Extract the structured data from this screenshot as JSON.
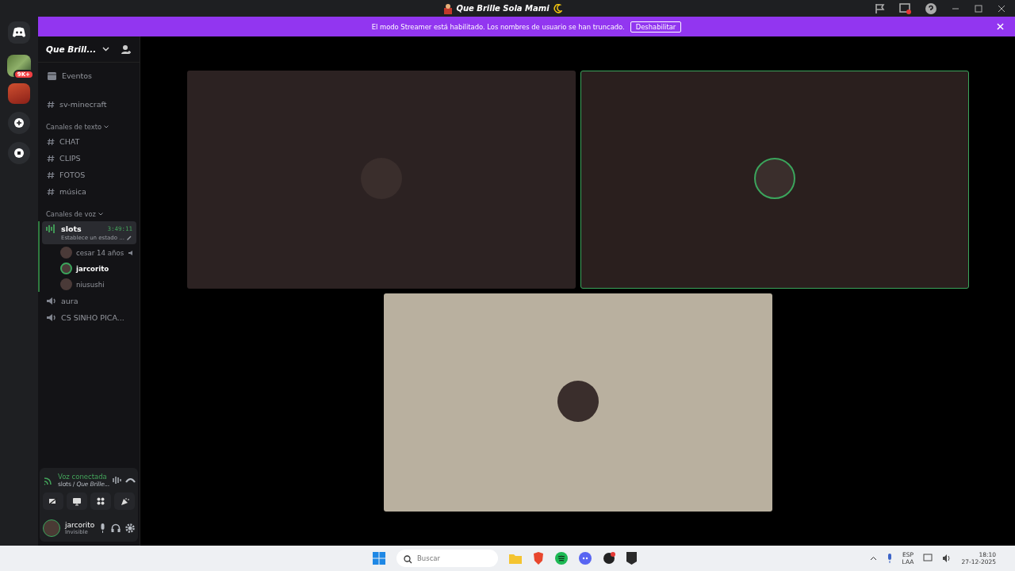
{
  "window": {
    "title": "Que Brille Sola Mami"
  },
  "banner": {
    "text": "El modo Streamer está habilitado. Los nombres de usuario se han truncado.",
    "button": "Deshabilitar"
  },
  "server_rail": {
    "badge": "9K+"
  },
  "server": {
    "name": "Que Brill..."
  },
  "top_channels": [
    {
      "kind": "events",
      "name": "Eventos"
    },
    {
      "kind": "text",
      "name": "sv-minecraft"
    }
  ],
  "categories": [
    {
      "name": "Canales de texto",
      "channels": [
        {
          "kind": "text",
          "name": "CHAT",
          "selected": false
        },
        {
          "kind": "text",
          "name": "CLIPS",
          "selected": false
        },
        {
          "kind": "text",
          "name": "FOTOS",
          "selected": false
        },
        {
          "kind": "text",
          "name": "música",
          "selected": false
        }
      ]
    },
    {
      "name": "Canales de voz",
      "channels": [
        {
          "kind": "voice",
          "name": "slots",
          "selected": true,
          "timer": "3:49:11",
          "status": "Establece un estado ...",
          "members": [
            {
              "name": "cesar 14 años",
              "speaking": false,
              "muted": true
            },
            {
              "name": "jarcorito",
              "speaking": true,
              "muted": false
            },
            {
              "name": "niusushi",
              "speaking": false,
              "muted": false
            }
          ]
        },
        {
          "kind": "voice",
          "name": "aura",
          "selected": false
        },
        {
          "kind": "voice",
          "name": "CS SINHO PICA...",
          "selected": false
        }
      ]
    }
  ],
  "voice_panel": {
    "status": "Voz conectada",
    "location": "slots / *Que Brille...*"
  },
  "user": {
    "name": "jarcorito",
    "status": "Invisible"
  },
  "tiles": [
    {
      "color": "#2c2222",
      "speaking": false
    },
    {
      "color": "#2a1f1e",
      "speaking": true
    },
    {
      "color": "#b9b09f",
      "speaking": false
    }
  ],
  "taskbar": {
    "search_placeholder": "Buscar",
    "lang": "ESP",
    "layout": "LAA",
    "time": "18:10",
    "date": "27-12-2025"
  }
}
